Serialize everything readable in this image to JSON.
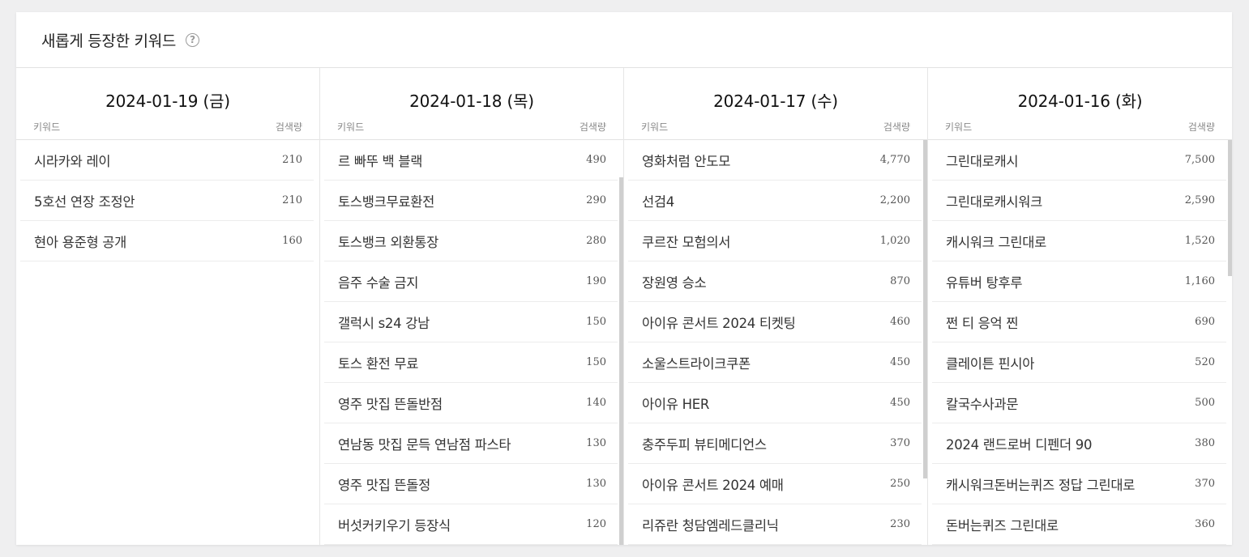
{
  "section": {
    "title": "새롭게 등장한 키워드",
    "help_icon": "question-circle-icon",
    "keyword_header": "키워드",
    "volume_header": "검색량"
  },
  "columns": [
    {
      "date": "2024-01-19 (금)",
      "rows": [
        {
          "keyword": "시라카와 레이",
          "volume": "210"
        },
        {
          "keyword": "5호선 연장 조정안",
          "volume": "210"
        },
        {
          "keyword": "현아 용준형 공개",
          "volume": "160"
        }
      ]
    },
    {
      "date": "2024-01-18 (목)",
      "rows": [
        {
          "keyword": "르 빠뚜 백 블랙",
          "volume": "490"
        },
        {
          "keyword": "토스뱅크무료환전",
          "volume": "290"
        },
        {
          "keyword": "토스뱅크 외환통장",
          "volume": "280"
        },
        {
          "keyword": "음주 수술 금지",
          "volume": "190"
        },
        {
          "keyword": "갤럭시 s24 강남",
          "volume": "150"
        },
        {
          "keyword": "토스 환전 무료",
          "volume": "150"
        },
        {
          "keyword": "영주 맛집 뜬돌반점",
          "volume": "140"
        },
        {
          "keyword": "연남동 맛집 문득 연남점 파스타",
          "volume": "130"
        },
        {
          "keyword": "영주 맛집 뜬돌정",
          "volume": "130"
        },
        {
          "keyword": "버섯커키우기 등장식",
          "volume": "120"
        }
      ]
    },
    {
      "date": "2024-01-17 (수)",
      "rows": [
        {
          "keyword": "영화처럼 안도모",
          "volume": "4,770"
        },
        {
          "keyword": "선검4",
          "volume": "2,200"
        },
        {
          "keyword": "쿠르잔 모험의서",
          "volume": "1,020"
        },
        {
          "keyword": "장원영 승소",
          "volume": "870"
        },
        {
          "keyword": "아이유 콘서트 2024 티켓팅",
          "volume": "460"
        },
        {
          "keyword": "소울스트라이크쿠폰",
          "volume": "450"
        },
        {
          "keyword": "아이유 HER",
          "volume": "450"
        },
        {
          "keyword": "충주두피 뷰티메디언스",
          "volume": "370"
        },
        {
          "keyword": "아이유 콘서트 2024 예매",
          "volume": "250"
        },
        {
          "keyword": "리쥬란 청담엠레드클리닉",
          "volume": "230"
        }
      ]
    },
    {
      "date": "2024-01-16 (화)",
      "rows": [
        {
          "keyword": "그린대로캐시",
          "volume": "7,500"
        },
        {
          "keyword": "그린대로캐시워크",
          "volume": "2,590"
        },
        {
          "keyword": "캐시워크 그린대로",
          "volume": "1,520"
        },
        {
          "keyword": "유튜버 탕후루",
          "volume": "1,160"
        },
        {
          "keyword": "쩐 티 응억 찐",
          "volume": "690"
        },
        {
          "keyword": "클레이튼 핀시아",
          "volume": "520"
        },
        {
          "keyword": "칼국수사과문",
          "volume": "500"
        },
        {
          "keyword": "2024 랜드로버 디펜더 90",
          "volume": "380"
        },
        {
          "keyword": "캐시워크돈버는퀴즈 정답 그린대로",
          "volume": "370"
        },
        {
          "keyword": "돈버는퀴즈 그린대로",
          "volume": "360"
        }
      ]
    }
  ]
}
